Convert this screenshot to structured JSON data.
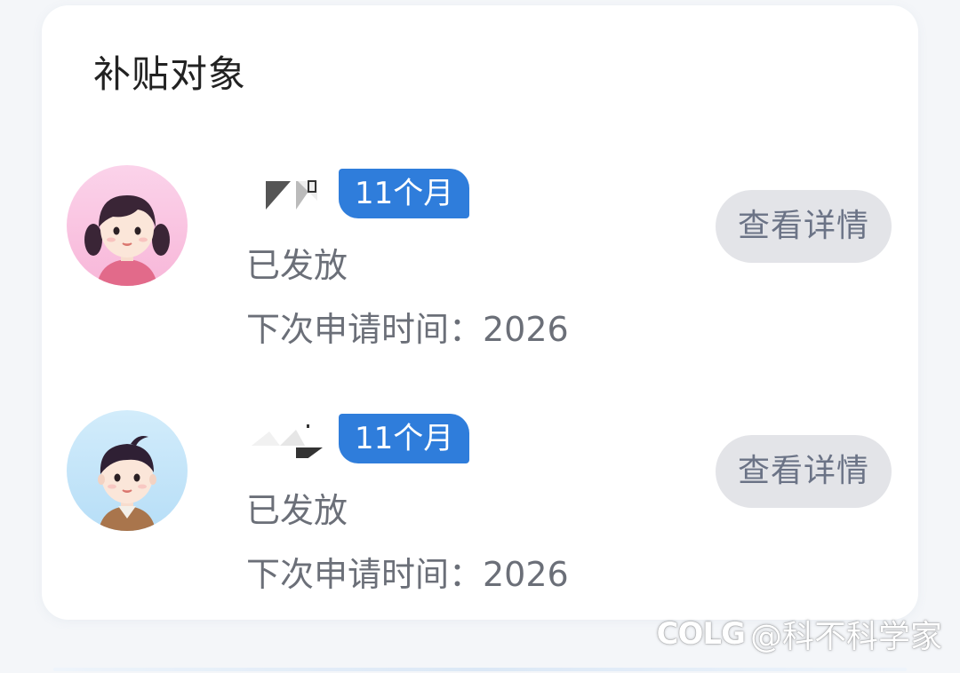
{
  "card": {
    "title": "补贴对象"
  },
  "persons": [
    {
      "avatar": "girl-avatar-icon",
      "duration_badge": "11个月",
      "status": "已发放",
      "next_apply": "下次申请时间：2026",
      "detail_label": "查看详情"
    },
    {
      "avatar": "boy-avatar-icon",
      "duration_badge": "11个月",
      "status": "已发放",
      "next_apply": "下次申请时间：2026",
      "detail_label": "查看详情"
    }
  ],
  "watermark": {
    "logo": "COLG",
    "text": "@科不科学家"
  },
  "colors": {
    "badge": "#2f7ddb",
    "button_bg": "#e3e4e8",
    "button_text": "#6b7386",
    "text_secondary": "#6b6f78"
  }
}
